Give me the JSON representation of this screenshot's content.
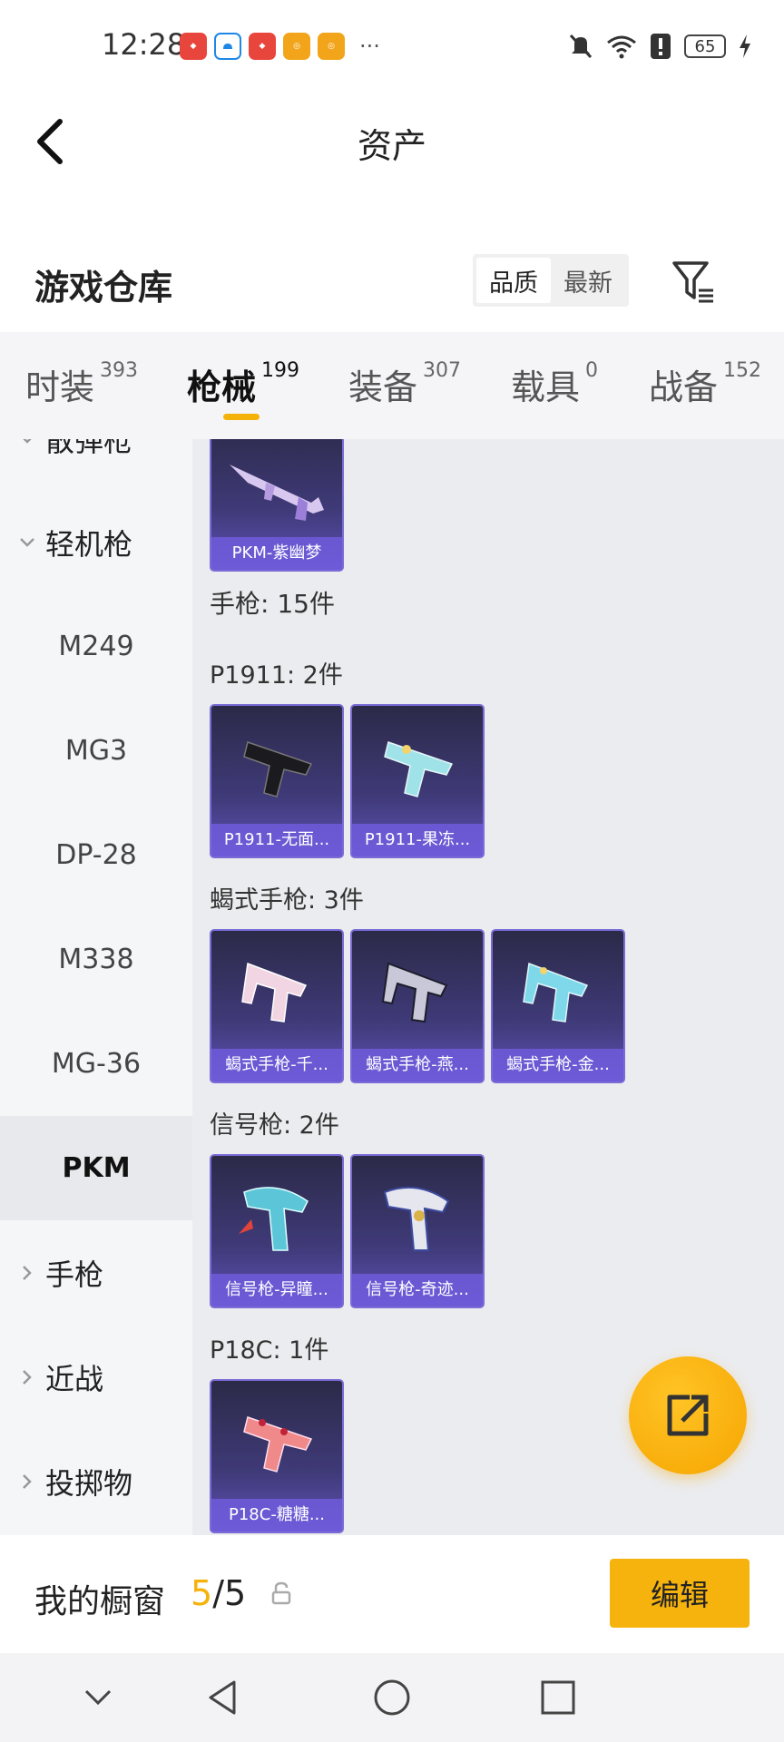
{
  "status_bar": {
    "time": "12:28",
    "app_icons": [
      "huawei-app-icon",
      "cloud-app-icon",
      "huawei-app-icon",
      "game-app-icon",
      "game-app-icon"
    ],
    "more": "···",
    "battery": "65"
  },
  "header": {
    "title": "资产"
  },
  "warehouse": {
    "title": "游戏仓库",
    "sort_options": [
      "品质",
      "最新"
    ],
    "active_sort": "品质"
  },
  "tabs": [
    {
      "label": "时装",
      "count": "393"
    },
    {
      "label": "枪械",
      "count": "199",
      "active": true
    },
    {
      "label": "装备",
      "count": "307"
    },
    {
      "label": "载具",
      "count": "0"
    },
    {
      "label": "战备",
      "count": "152"
    }
  ],
  "sidebar": {
    "partial_top": "散弹枪",
    "lmg_category": "轻机枪",
    "lmg_items": [
      "M249",
      "MG3",
      "DP-28",
      "M338",
      "MG-36",
      "PKM"
    ],
    "selected": "PKM",
    "categories": [
      "手枪",
      "近战",
      "投掷物"
    ]
  },
  "content": {
    "top_card": "PKM-紫幽梦",
    "section_pistol": "手枪: 15件",
    "groups": [
      {
        "label": "P1911: 2件",
        "cards": [
          "P1911-无面...",
          "P1911-果冻..."
        ]
      },
      {
        "label": "蝎式手枪: 3件",
        "cards": [
          "蝎式手枪-千...",
          "蝎式手枪-燕...",
          "蝎式手枪-金..."
        ]
      },
      {
        "label": "信号枪: 2件",
        "cards": [
          "信号枪-异瞳...",
          "信号枪-奇迹..."
        ]
      },
      {
        "label": "P18C: 1件",
        "cards": [
          "P18C-糖糖..."
        ]
      }
    ]
  },
  "bottom_bar": {
    "label": "我的橱窗",
    "current": "5",
    "separator": "/",
    "total": "5",
    "edit_label": "编辑"
  },
  "colors": {
    "accent": "#f5b20a",
    "card_bg": "#3f3a78",
    "card_border": "#7a6cd6"
  }
}
